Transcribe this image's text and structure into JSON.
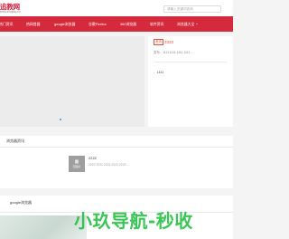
{
  "header": {
    "logo_main": "追教网",
    "logo_sub": "www.zhuijiao.cn",
    "search_placeholder": "请输入关键词查询"
  },
  "nav": {
    "items": [
      "热门资讯",
      "热网首器",
      "google浏览器",
      "谷歌Firefox",
      "360浏览器",
      "软件资讯",
      "浏览器大全"
    ]
  },
  "feature": {
    "tag": "资讯",
    "title": "3333",
    "desc": "发布：1111 1111 1111 1111 ...",
    "list_item": "1111"
  },
  "news": {
    "section_title": "浏览器资讯",
    "thumb_top": "图",
    "thumb_bottom": "无图片",
    "item_title": "2222",
    "item_desc": "2222 2222 2222 2222 2222 ..."
  },
  "browser_section": {
    "title": "google浏览器"
  },
  "watermark": "小玖导航-秒收",
  "colors": {
    "nav_bg": "#d52a3b",
    "accent": "#e5533d",
    "watermark": "#1ebe3c"
  }
}
